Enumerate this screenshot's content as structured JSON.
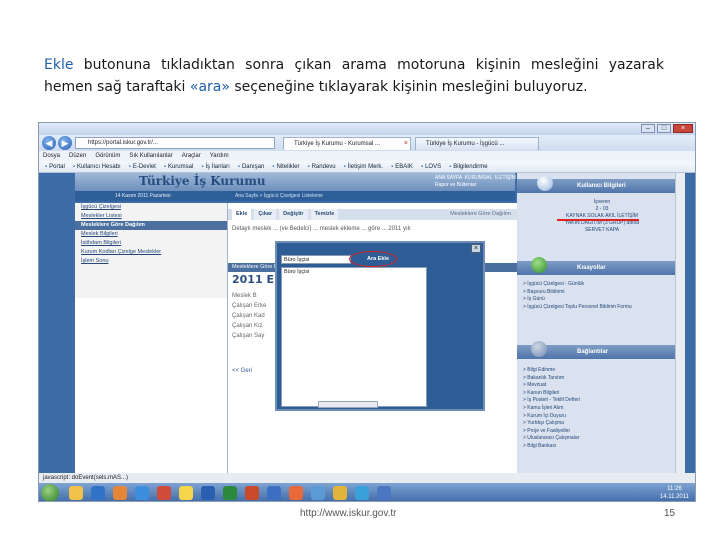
{
  "slide": {
    "caption_part1": "Ekle",
    "caption_part2": " butonuna tıkladıktan sonra çıkan arama motoruna kişinin mesleğini yazarak hemen sağ taraftaki ",
    "caption_part3": "«ara»",
    "caption_part4": " seçeneğine tıklayarak kişinin mesleğini buluyoruz.",
    "footer_url": "http://www.iskur.gov.tr",
    "page_number": "15",
    "highlight_color": "#1f5fa8"
  },
  "browser": {
    "address": "https://portal.iskur.gov.tr/...",
    "tabs": [
      "Türkiye İş Kurumu - Kurumsal ...",
      "Türkiye İş Kurumu - İşgücü ..."
    ],
    "menu": [
      "Dosya",
      "Düzen",
      "Görünüm",
      "Sık Kullanılanlar",
      "Araçlar",
      "Yardım"
    ],
    "favorites": [
      "Portal",
      "Kullanıcı Hesabı",
      "E-Devlet",
      "Kurumsal",
      "İş İlanları",
      "Danışan",
      "Nitelikler",
      "Randevu",
      "İletişim Merk.",
      "EBAIK",
      "LOVS",
      "Bilgilendirme"
    ],
    "status": "javascript: doEvent(sels.mAS...)"
  },
  "site": {
    "header": "Türkiye İş Kurumu",
    "header_right": "ANA SAYFA  KURUMSAL  İLETİŞİM\nRapor ve Bülteniar",
    "date": "14 Kasım 2011 Pazartesi",
    "breadcrumb": "Ana Sayfa > İşgücü Çizelgesi Listeleme",
    "left_nav": [
      "İşgücü Çizelgesi",
      "Meslekler Listesi",
      "Mesleklere Göre Dağılım",
      "Meslek Bilgileri",
      "İstihdam Bilgileri",
      "Kurum Kodları Çizelge Meslekler",
      "İşlem Sonu"
    ]
  },
  "content": {
    "tabs": [
      "Ekle",
      "Çıkar",
      "Değiştir",
      "Temizle"
    ],
    "panel_title": "Mesleklere Göre Dağılım",
    "body_text": "Detaylı meslek ... (ve Bedelci) ... meslek ekleme ... göre ... 2011 yılı",
    "section": "Mesleklere Göre Dağılım",
    "big_title": "2011 E",
    "fields": [
      "Meslek B",
      "Çalışan Erke",
      "Çalışan Kad",
      "Çalışan Kız",
      "Çalışan Say"
    ],
    "back": "<< Geri"
  },
  "modal": {
    "search_value": "Büro İşçisi",
    "search_button": "Ara Ekle",
    "options": [
      "Büro İşçisi"
    ],
    "close": "×"
  },
  "sidebar": {
    "user_head": "Kullanıcı Bilgileri",
    "user_info": "İşveren\n2 - 03\nKAYNAK SOLAK AKIL İLETİŞİM\nYAKIN DAĞITIM (3 GRUP) adına\nSERVET KAPA",
    "shortcuts_head": "Kısayollar",
    "shortcuts": [
      "> İşgücü Çizelgesi - Günlük",
      "> Başvuru Bildirimi",
      "> İş Günü",
      "> İşgücü Çizelgesi Toplu Personel Bildirim Formu"
    ],
    "links_head": "Bağlantılar",
    "links": [
      "> Bilgi Edinme",
      "> Bakanlık Tanıtım",
      "> Mevzuat",
      "    > Kanun Bilgileri",
      "    > İş Posteri - Teklif Defteri",
      "> Kamu İşleri Alım",
      "> Kurum İçi Duyuru",
      "> Yurtdışı Çalışma",
      "> Proje ve Faaliyetler",
      "> Uluslararası Çalışmalar",
      "> Bilgi Bankası"
    ]
  },
  "taskbar": {
    "time": "11:26",
    "date": "14.11.2011"
  }
}
